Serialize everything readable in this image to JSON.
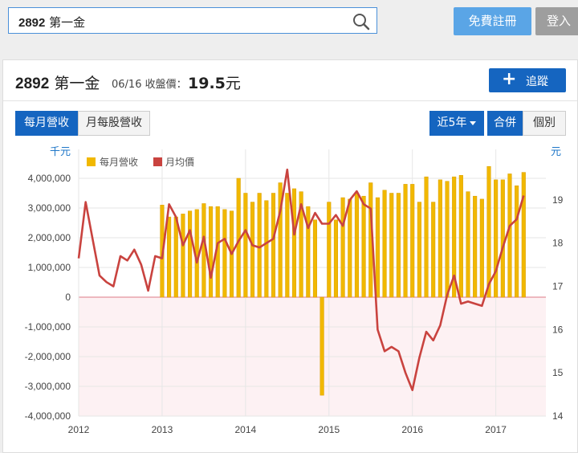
{
  "search": {
    "code": "2892",
    "name": "第一金"
  },
  "header_buttons": {
    "signup": "免費註冊",
    "login": "登入"
  },
  "stock": {
    "code": "2892",
    "name": "第一金",
    "date": "06/16",
    "price_label": "收盤價：",
    "price": "19.5",
    "price_unit": "元"
  },
  "actions": {
    "track": "追蹤",
    "track_icon": "plus-icon"
  },
  "tabs": {
    "monthly_revenue": "每月營收",
    "monthly_eps": "月每股營收",
    "period": "近5年",
    "merged": "合併",
    "single": "個別"
  },
  "colors": {
    "bar": "#f1b800",
    "bar_edge": "#d99e00",
    "line": "#c9433f",
    "accent": "#1565c0",
    "axis_label": "#1f77c8"
  },
  "chart_data": {
    "type": "bar",
    "left_unit": "千元",
    "right_unit": "元",
    "legend": [
      "每月營收",
      "月均價"
    ],
    "x_ticks": [
      "2012",
      "2013",
      "2014",
      "2015",
      "2016",
      "2017"
    ],
    "y_left": {
      "min": -4000000,
      "max": 4000000,
      "ticks": [
        "4,000,000",
        "3,000,000",
        "2,000,000",
        "1,000,000",
        "0",
        "-1,000,000",
        "-2,000,000",
        "-3,000,000",
        "-4,000,000"
      ]
    },
    "y_right": {
      "min": 14,
      "max": 19.5,
      "ticks": [
        "19",
        "18",
        "17",
        "16",
        "15",
        "14"
      ]
    },
    "series": [
      {
        "name": "每月營收",
        "type": "bar",
        "points": [
          [
            "2013-01",
            3100000
          ],
          [
            "2013-02",
            2700000
          ],
          [
            "2013-03",
            2700000
          ],
          [
            "2013-04",
            2800000
          ],
          [
            "2013-05",
            2900000
          ],
          [
            "2013-06",
            2950000
          ],
          [
            "2013-07",
            3150000
          ],
          [
            "2013-08",
            3050000
          ],
          [
            "2013-09",
            3050000
          ],
          [
            "2013-10",
            2950000
          ],
          [
            "2013-11",
            2900000
          ],
          [
            "2013-12",
            4000000
          ],
          [
            "2014-01",
            3500000
          ],
          [
            "2014-02",
            3200000
          ],
          [
            "2014-03",
            3500000
          ],
          [
            "2014-04",
            3250000
          ],
          [
            "2014-05",
            3500000
          ],
          [
            "2014-06",
            3850000
          ],
          [
            "2014-07",
            3500000
          ],
          [
            "2014-08",
            3650000
          ],
          [
            "2014-09",
            3550000
          ],
          [
            "2014-10",
            3050000
          ],
          [
            "2014-11",
            2600000
          ],
          [
            "2014-12",
            -3300000
          ],
          [
            "2015-01",
            3200000
          ],
          [
            "2015-02",
            2600000
          ],
          [
            "2015-03",
            3350000
          ],
          [
            "2015-04",
            3300000
          ],
          [
            "2015-05",
            3500000
          ],
          [
            "2015-06",
            3400000
          ],
          [
            "2015-07",
            3850000
          ],
          [
            "2015-08",
            3350000
          ],
          [
            "2015-09",
            3600000
          ],
          [
            "2015-10",
            3500000
          ],
          [
            "2015-11",
            3500000
          ],
          [
            "2015-12",
            3800000
          ],
          [
            "2016-01",
            3800000
          ],
          [
            "2016-02",
            3200000
          ],
          [
            "2016-03",
            4050000
          ],
          [
            "2016-04",
            3200000
          ],
          [
            "2016-05",
            3950000
          ],
          [
            "2016-06",
            3900000
          ],
          [
            "2016-07",
            4050000
          ],
          [
            "2016-08",
            4100000
          ],
          [
            "2016-09",
            3550000
          ],
          [
            "2016-10",
            3400000
          ],
          [
            "2016-11",
            3300000
          ],
          [
            "2016-12",
            4400000
          ],
          [
            "2017-01",
            3950000
          ],
          [
            "2017-02",
            3950000
          ],
          [
            "2017-03",
            4150000
          ],
          [
            "2017-04",
            3750000
          ],
          [
            "2017-05",
            4200000
          ]
        ]
      },
      {
        "name": "月均價",
        "type": "line",
        "points": [
          [
            "2012-01",
            17.65
          ],
          [
            "2012-02",
            18.95
          ],
          [
            "2012-03",
            18.1
          ],
          [
            "2012-04",
            17.25
          ],
          [
            "2012-05",
            17.1
          ],
          [
            "2012-06",
            17.0
          ],
          [
            "2012-07",
            17.7
          ],
          [
            "2012-08",
            17.6
          ],
          [
            "2012-09",
            17.85
          ],
          [
            "2012-10",
            17.5
          ],
          [
            "2012-11",
            16.9
          ],
          [
            "2012-12",
            17.7
          ],
          [
            "2013-01",
            17.65
          ],
          [
            "2013-02",
            18.9
          ],
          [
            "2013-03",
            18.6
          ],
          [
            "2013-04",
            17.95
          ],
          [
            "2013-05",
            18.3
          ],
          [
            "2013-06",
            17.55
          ],
          [
            "2013-07",
            18.15
          ],
          [
            "2013-08",
            17.2
          ],
          [
            "2013-09",
            18.0
          ],
          [
            "2013-10",
            18.1
          ],
          [
            "2013-11",
            17.75
          ],
          [
            "2013-12",
            18.05
          ],
          [
            "2014-01",
            18.3
          ],
          [
            "2014-02",
            17.95
          ],
          [
            "2014-03",
            17.9
          ],
          [
            "2014-04",
            18.0
          ],
          [
            "2014-05",
            18.1
          ],
          [
            "2014-06",
            18.75
          ],
          [
            "2014-07",
            19.7
          ],
          [
            "2014-08",
            18.2
          ],
          [
            "2014-09",
            18.9
          ],
          [
            "2014-10",
            18.35
          ],
          [
            "2014-11",
            18.7
          ],
          [
            "2014-12",
            18.45
          ],
          [
            "2015-01",
            18.45
          ],
          [
            "2015-02",
            18.65
          ],
          [
            "2015-03",
            18.4
          ],
          [
            "2015-04",
            19.0
          ],
          [
            "2015-05",
            19.2
          ],
          [
            "2015-06",
            18.9
          ],
          [
            "2015-07",
            18.8
          ],
          [
            "2015-08",
            16.0
          ],
          [
            "2015-09",
            15.5
          ],
          [
            "2015-10",
            15.6
          ],
          [
            "2015-11",
            15.5
          ],
          [
            "2015-12",
            15.0
          ],
          [
            "2016-01",
            14.6
          ],
          [
            "2016-02",
            15.35
          ],
          [
            "2016-03",
            15.95
          ],
          [
            "2016-04",
            15.75
          ],
          [
            "2016-05",
            16.1
          ],
          [
            "2016-06",
            16.8
          ],
          [
            "2016-07",
            17.25
          ],
          [
            "2016-08",
            16.6
          ],
          [
            "2016-09",
            16.65
          ],
          [
            "2016-10",
            16.6
          ],
          [
            "2016-11",
            16.55
          ],
          [
            "2016-12",
            17.05
          ],
          [
            "2017-01",
            17.35
          ],
          [
            "2017-02",
            17.9
          ],
          [
            "2017-03",
            18.4
          ],
          [
            "2017-04",
            18.55
          ],
          [
            "2017-05",
            19.1
          ]
        ]
      }
    ]
  }
}
